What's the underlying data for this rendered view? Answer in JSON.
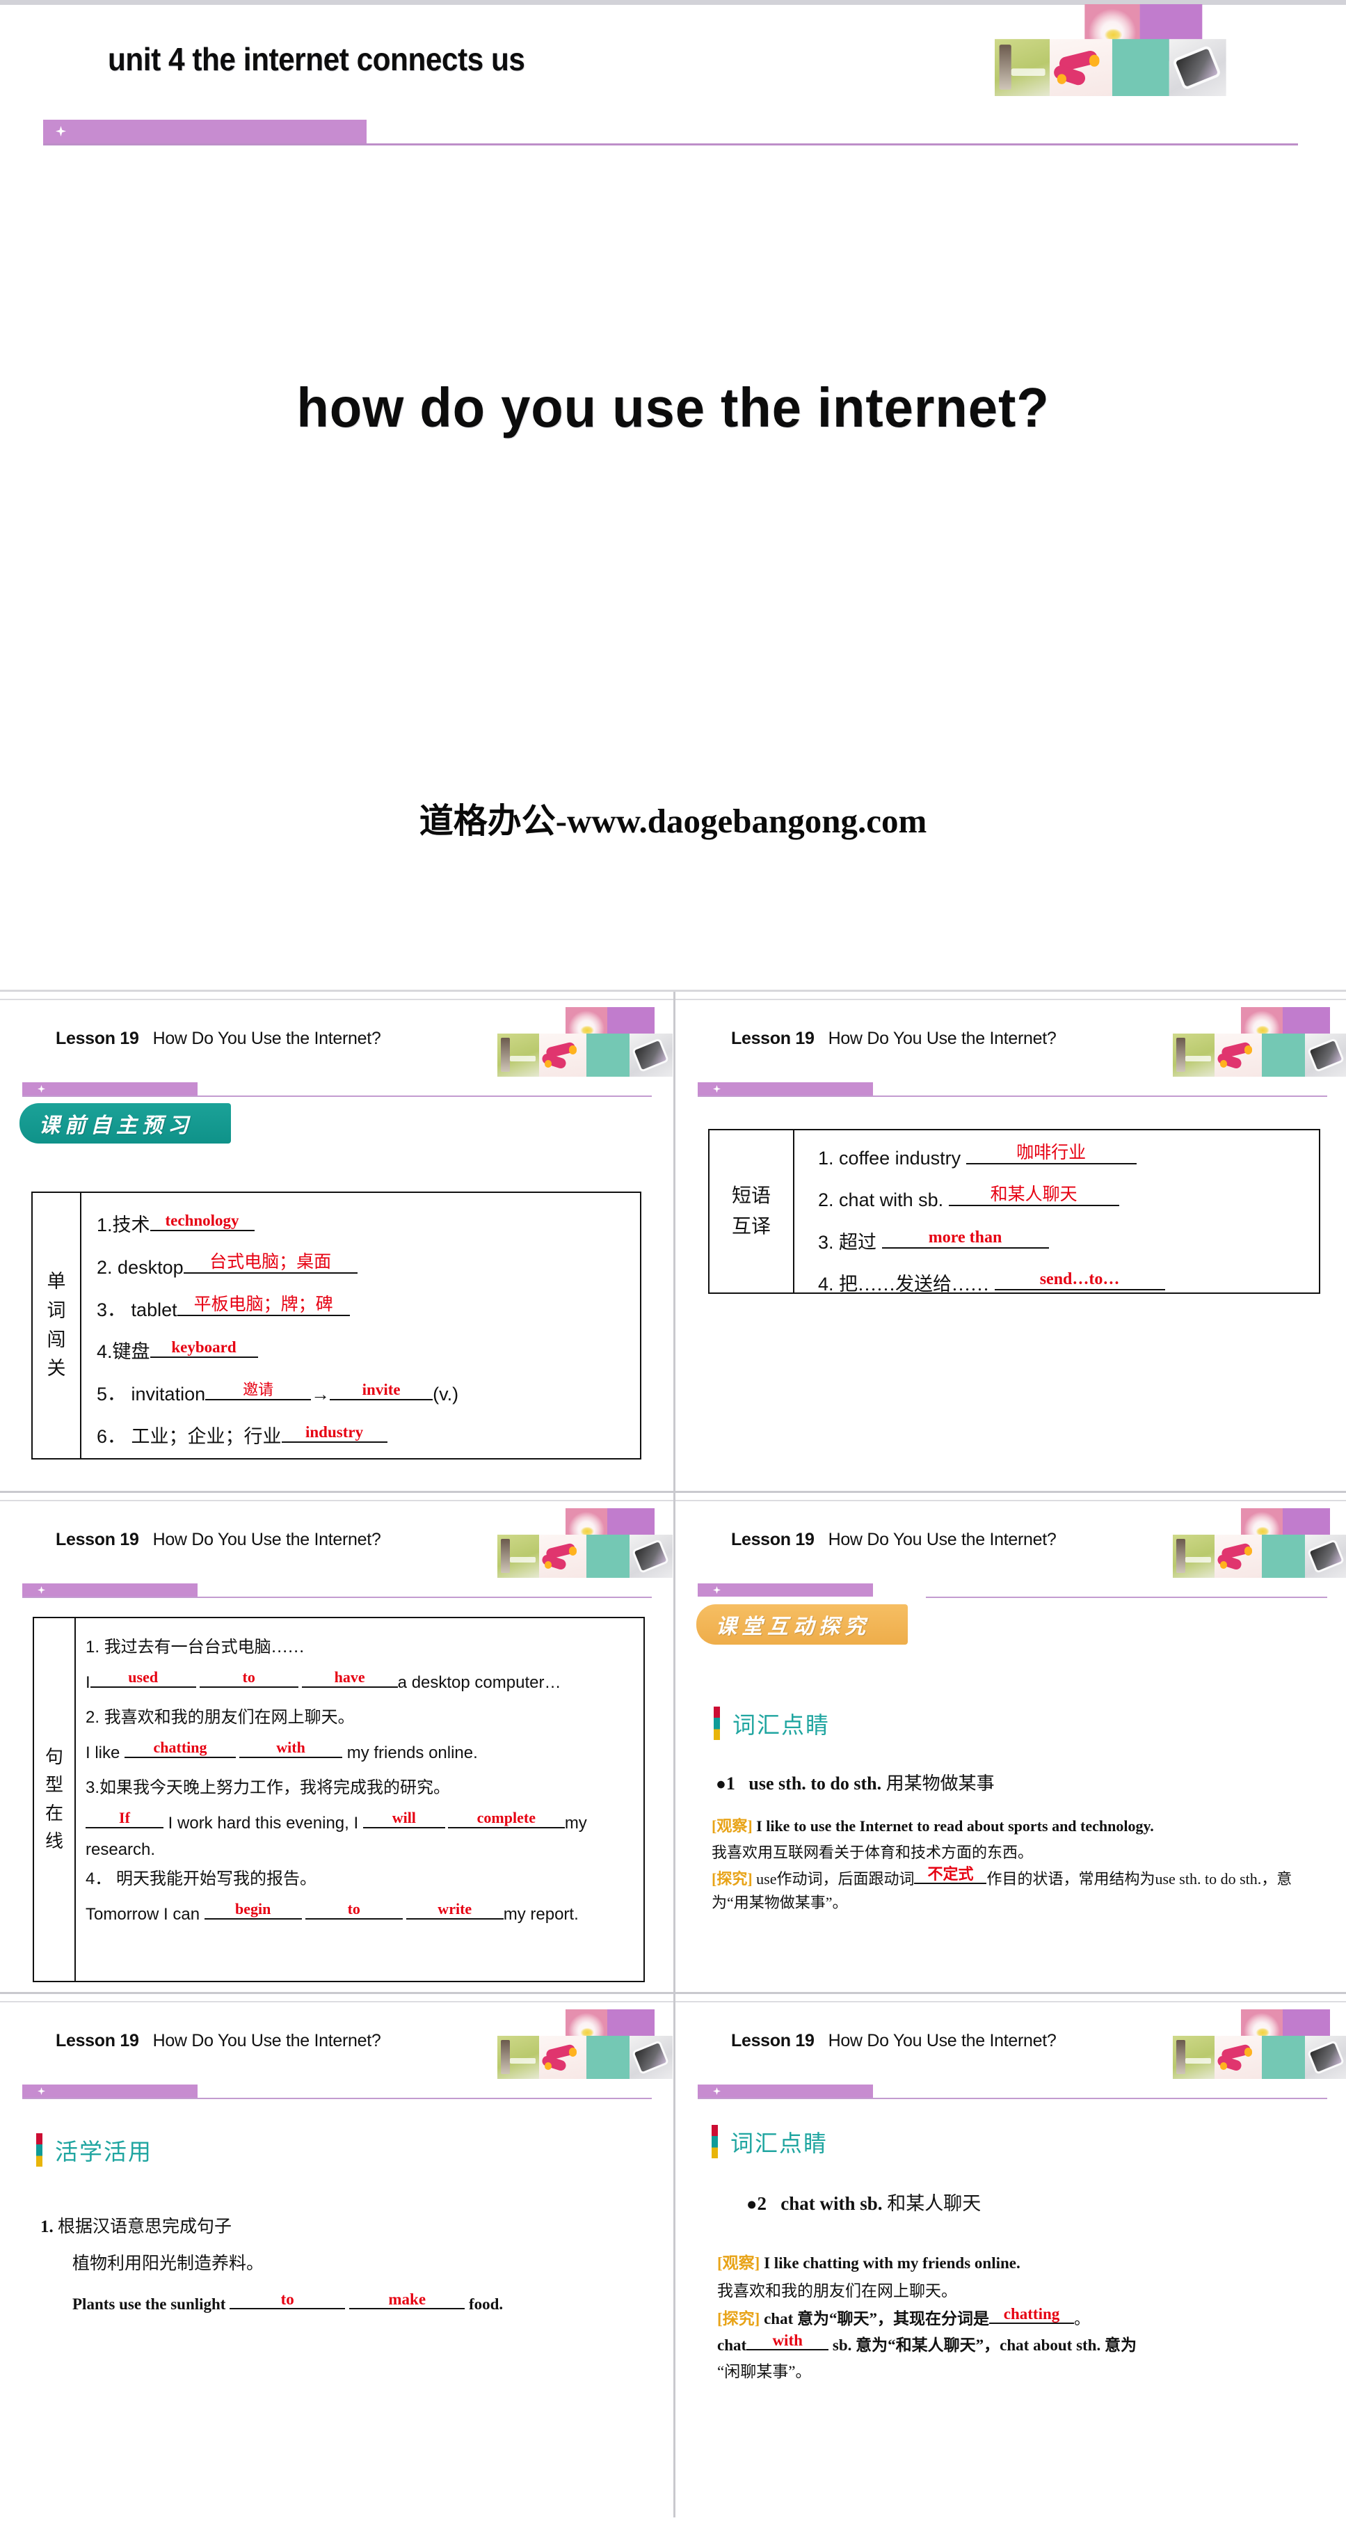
{
  "cover": {
    "unit_title": "unit 4   the internet connects us",
    "main_title": "how do you use the internet?",
    "watermark": "道格办公-www.daogebangong.com"
  },
  "slide_header": {
    "lesson": "Lesson 19",
    "title": "How Do You Use the Internet?"
  },
  "colors": {
    "purple_bar": "#c78cd0",
    "teal_badge": "#0f9289",
    "orange_badge": "#eead4a",
    "answer_red": "#e60012",
    "heading_teal": "#1fa5a0",
    "tag_orange": "#e8a317"
  },
  "slides": [
    {
      "id": "slide-1-vocab",
      "badge": {
        "text": "课前自主预习",
        "style": "teal"
      },
      "table": {
        "col_head": [
          "单",
          "词",
          "闯",
          "关"
        ],
        "rows": [
          {
            "num": "1.",
            "prompt": "技术",
            "answers": [
              "technology"
            ]
          },
          {
            "num": "2.",
            "prompt": "desktop",
            "answers": [
              "台式电脑；桌面"
            ]
          },
          {
            "num": "3．",
            "prompt": "tablet",
            "answers": [
              "平板电脑；牌；碑"
            ]
          },
          {
            "num": "4.",
            "prompt": "键盘",
            "answers": [
              "keyboard"
            ]
          },
          {
            "num": "5．",
            "prompt": "invitation",
            "answers": [
              "邀请",
              "invite"
            ],
            "arrow": "→",
            "suffix": "(v.)"
          },
          {
            "num": "6．",
            "prompt": "工业；企业；行业",
            "answers": [
              "industry"
            ]
          }
        ]
      }
    },
    {
      "id": "slide-2-phrases",
      "table": {
        "col_head": [
          "短语",
          "互译"
        ],
        "rows": [
          {
            "num": "1.",
            "prompt": "coffee industry",
            "answers": [
              "咖啡行业"
            ]
          },
          {
            "num": "2.",
            "prompt": "chat with sb.",
            "answers": [
              "和某人聊天"
            ]
          },
          {
            "num": "3.",
            "prompt": "超过",
            "answers": [
              "more than"
            ]
          },
          {
            "num": "4.",
            "prompt": "把……发送给……",
            "answers": [
              "send…to…"
            ]
          }
        ]
      }
    },
    {
      "id": "slide-3-sentences",
      "table": {
        "col_head": [
          "句",
          "型",
          "在",
          "线"
        ],
        "items": [
          {
            "num": "1.",
            "cn": "我过去有一台台式电脑……",
            "en_pre": "I",
            "answers": [
              "used",
              "to",
              "have"
            ],
            "en_post": "a desktop computer…"
          },
          {
            "num": "2.",
            "cn": "我喜欢和我的朋友们在网上聊天。",
            "en_pre": "I like",
            "answers": [
              "chatting",
              "with"
            ],
            "en_post": "my friends online."
          },
          {
            "num": "3.",
            "cn": "如果我今天晚上努力工作，我将完成我的研究。",
            "en_pre": "",
            "answers": [
              "If",
              "will",
              "complete"
            ],
            "en_mid1": "I work hard this evening, I",
            "en_post": "my",
            "en_tail": "research."
          },
          {
            "num": "4．",
            "cn": "明天我能开始写我的报告。",
            "en_pre": "Tomorrow I can",
            "answers": [
              "begin",
              "to",
              "write"
            ],
            "en_post": "my report."
          }
        ]
      }
    },
    {
      "id": "slide-4-point1",
      "badge": {
        "text": "课堂互动探究",
        "style": "orange"
      },
      "marker_head": "词汇点睛",
      "point": {
        "number": "1",
        "headword": "use sth. to do sth.",
        "headword_cn": "用某物做某事",
        "observe_tag": "[观察]",
        "observe_en": "I like to use the Internet to read about sports and technology.",
        "observe_cn": "我喜欢用互联网看关于体育和技术方面的东西。",
        "explore_tag": "[探究]",
        "explore_pre": "use作动词，后面跟动词",
        "explore_answer": "不定式",
        "explore_mid": "作目的状语，常用结构为use sth. to do sth.，意为“用某物做某事”。"
      }
    },
    {
      "id": "slide-5-practice",
      "marker_head": "活学活用",
      "practice": {
        "num": "1.",
        "instruction": "根据汉语意思完成句子",
        "cn_sentence": "植物利用阳光制造养料。",
        "en_pre": "Plants use the sunlight",
        "answers": [
          "to",
          "make"
        ],
        "en_post": "food."
      }
    },
    {
      "id": "slide-6-point2",
      "marker_head": "词汇点睛",
      "point": {
        "number": "2",
        "headword": "chat with sb.",
        "headword_cn": "和某人聊天",
        "observe_tag": "[观察]",
        "observe_en": "I like chatting with my friends online.",
        "observe_cn": "我喜欢和我的朋友们在网上聊天。",
        "explore_tag": "[探究]",
        "explore_pre": "chat 意为“聊天”，其现在分词是",
        "explore_answer": "chatting",
        "explore_after": "。",
        "explore_line2_pre": "chat",
        "explore_line2_answer": "with",
        "explore_line2_post": "sb. 意为“和某人聊天”，chat about sth. 意为",
        "explore_line3": "“闲聊某事”。"
      }
    }
  ]
}
